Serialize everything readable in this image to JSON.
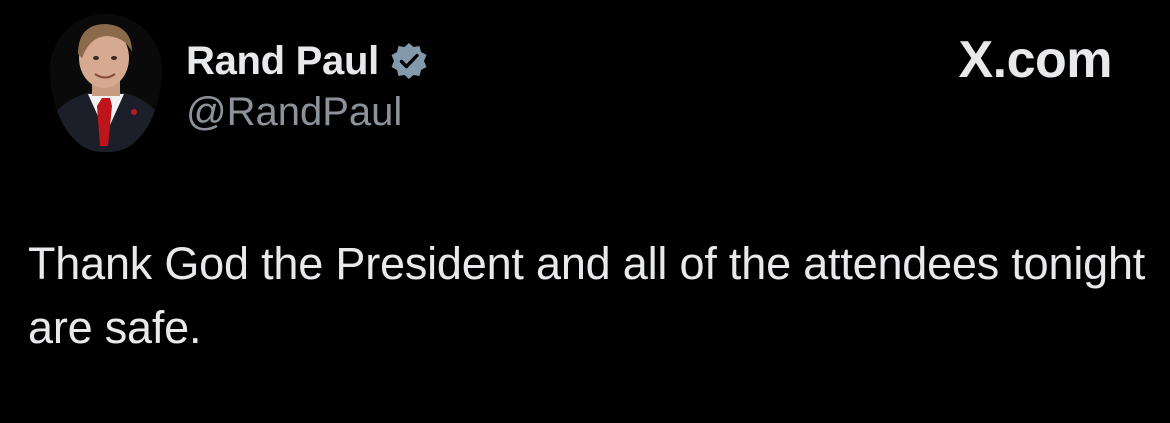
{
  "tweet": {
    "author": {
      "display_name": "Rand Paul",
      "handle": "@RandPaul",
      "verified": true,
      "verified_color": "#829aab",
      "avatar_icon": "profile-photo"
    },
    "source_label": "X.com",
    "text": "Thank God the President and all of the attendees tonight are safe."
  },
  "colors": {
    "background": "#000000",
    "primary_text": "#e7e9ea",
    "secondary_text": "#8b9299"
  }
}
